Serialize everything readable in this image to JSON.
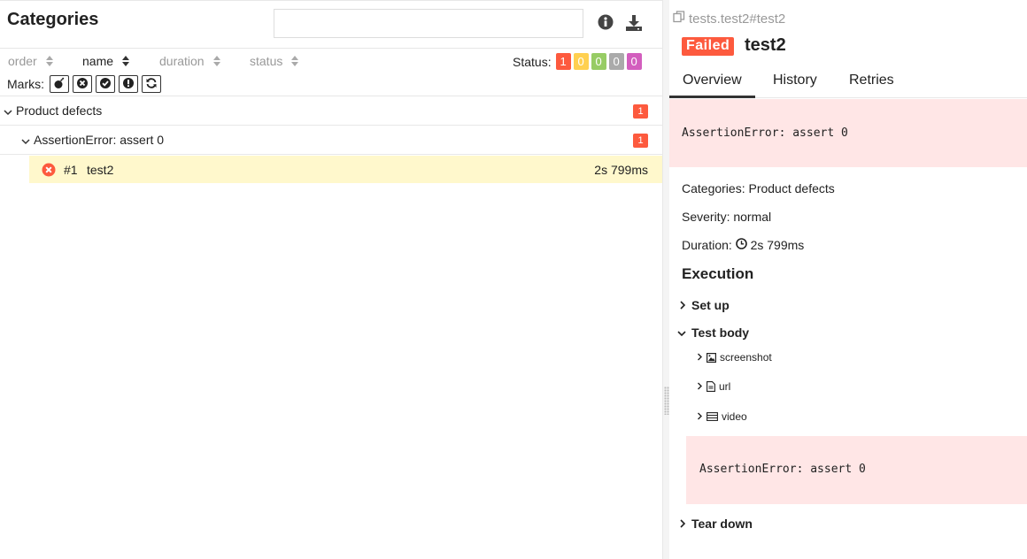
{
  "left": {
    "title": "Categories",
    "search": {
      "value": "",
      "placeholder": ""
    },
    "icons": {
      "info": "info-icon",
      "download": "download-icon"
    },
    "sort": [
      {
        "label": "order",
        "active": false
      },
      {
        "label": "name",
        "active": true
      },
      {
        "label": "duration",
        "active": false
      },
      {
        "label": "status",
        "active": false
      }
    ],
    "status_label": "Status:",
    "status_counts": [
      {
        "name": "failed",
        "value": "1",
        "color": "#fd5a3e"
      },
      {
        "name": "broken",
        "value": "0",
        "color": "#ffd050"
      },
      {
        "name": "passed",
        "value": "0",
        "color": "#97cc64"
      },
      {
        "name": "skipped",
        "value": "0",
        "color": "#aaaaaa"
      },
      {
        "name": "unknown",
        "value": "0",
        "color": "#d35ebe"
      }
    ],
    "marks_label": "Marks:",
    "marks": [
      "bomb-icon",
      "close-circle-icon",
      "check-circle-icon",
      "exclamation-circle-icon",
      "refresh-icon"
    ],
    "tree": {
      "group": {
        "label": "Product defects",
        "count": "1"
      },
      "subgroup": {
        "label": "AssertionError: assert 0",
        "count": "1"
      },
      "test": {
        "number": "#1",
        "name": "test2",
        "duration": "2s 799ms"
      }
    }
  },
  "right": {
    "path": "tests.test2#test2",
    "status": "Failed",
    "title": "test2",
    "tabs": [
      "Overview",
      "History",
      "Retries"
    ],
    "error": "AssertionError: assert 0",
    "meta": {
      "categories_label": "Categories:",
      "categories_value": "Product defects",
      "severity_label": "Severity:",
      "severity_value": "normal",
      "duration_label": "Duration:",
      "duration_value": "2s 799ms"
    },
    "execution_title": "Execution",
    "steps": {
      "setup": "Set up",
      "body": "Test body",
      "teardown": "Tear down"
    },
    "attachments": [
      {
        "name": "screenshot",
        "icon": "image-icon"
      },
      {
        "name": "url",
        "icon": "file-icon"
      },
      {
        "name": "video",
        "icon": "list-icon"
      }
    ],
    "body_error": "AssertionError: assert 0"
  }
}
